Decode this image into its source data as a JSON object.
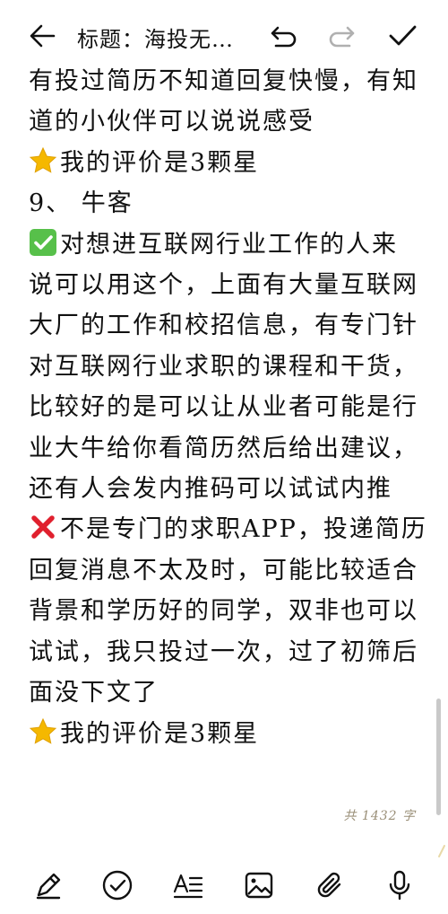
{
  "header": {
    "title": "标题：海投无…",
    "back_icon": "back-arrow-icon",
    "undo_icon": "undo-icon",
    "redo_icon": "redo-icon",
    "done_icon": "checkmark-icon"
  },
  "note": {
    "lines": [
      "有投过简历不知道回复快慢，有知",
      "道的小伙伴可以说说感受",
      "我的评价是3颗星",
      "9、 牛客",
      "对想进互联网行业工作的人来",
      "说可以用这个，上面有大量互联网",
      "大厂的工作和校招信息，有专门针",
      "对互联网行业求职的课程和干货，",
      "比较好的是可以让从业者可能是行",
      "业大牛给你看简历然后给出建议，",
      "还有人会发内推码可以试试内推",
      "不是专门的求职APP，投递简历",
      "回复消息不太及时，可能比较适合",
      "背景和学历好的同学，双非也可以",
      "试试，我只投过一次，过了初筛后",
      "面没下文了",
      "我的评价是3颗星"
    ],
    "emoji_names": [
      "star-emoji",
      "check-mark-emoji",
      "cross-mark-emoji",
      "star-emoji"
    ]
  },
  "footer": {
    "word_count": "共 1432 字"
  },
  "toolbar": {
    "icons": [
      "pen-icon",
      "checklist-icon",
      "text-format-icon",
      "image-icon",
      "attachment-icon",
      "microphone-icon"
    ]
  },
  "colors": {
    "text": "#111111",
    "star": "#f5b800",
    "check": "#57c04a",
    "cross": "#e0202e",
    "disabled_icon": "#b0b0b0",
    "word_count": "#9a8f78"
  }
}
